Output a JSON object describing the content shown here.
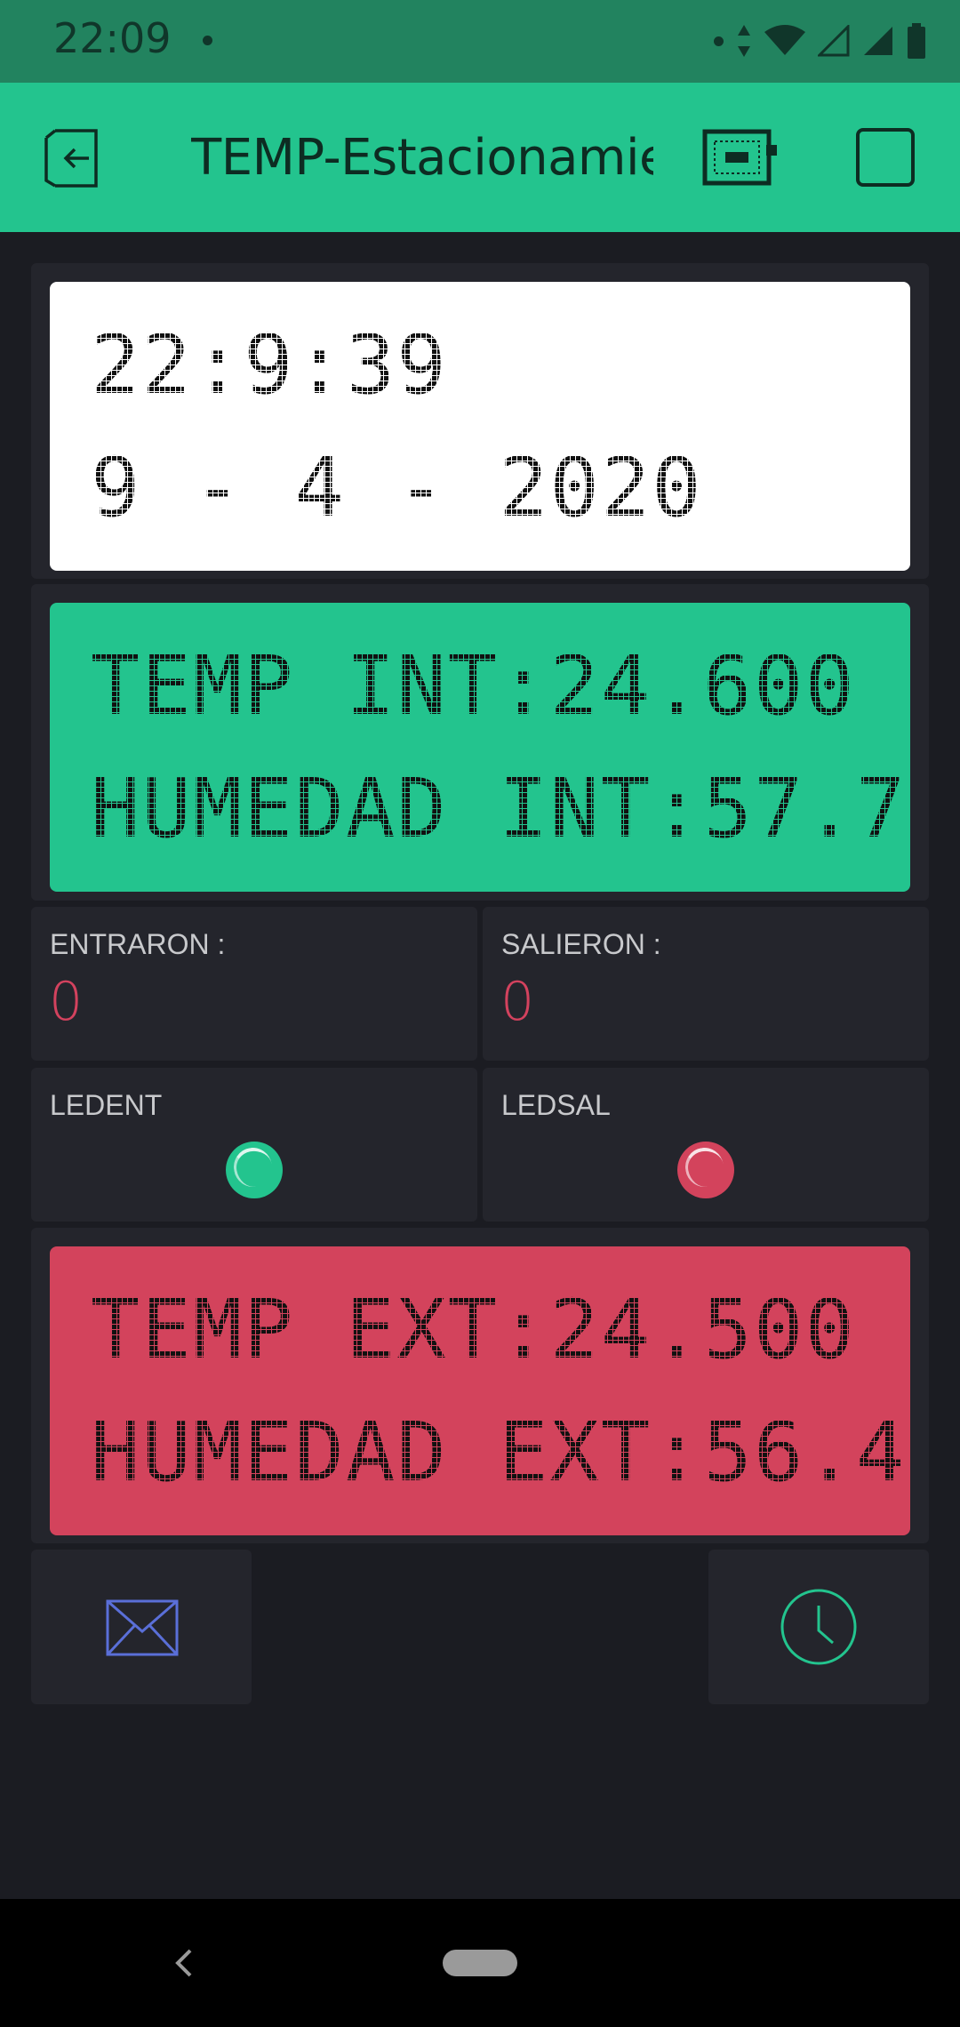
{
  "status_bar": {
    "time": "22:09"
  },
  "app_bar": {
    "title": "TEMP-Estacionamiento",
    "icons": [
      "exit-icon",
      "device-icon",
      "square-icon"
    ]
  },
  "widgets": {
    "datetime_lcd": {
      "line1": "22:9:39",
      "line2": "9 - 4 - 2020",
      "color": "#ffffff"
    },
    "interior_lcd": {
      "line1": "TEMP INT:24.600",
      "line2": "HUMEDAD INT:57.7",
      "color": "#23c48e"
    },
    "entraron": {
      "label": "ENTRARON :",
      "value": "0"
    },
    "salieron": {
      "label": "SALIERON :",
      "value": "0"
    },
    "ledent": {
      "label": "LEDENT",
      "color": "#23c48e"
    },
    "ledsal": {
      "label": "LEDSAL",
      "color": "#d3435c"
    },
    "exterior_lcd": {
      "line1": "TEMP EXT:24.500",
      "line2": "HUMEDAD EXT:56.4",
      "color": "#d3435c"
    },
    "email_widget": {
      "icon": "email-icon"
    },
    "timer_widget": {
      "icon": "clock-icon"
    }
  },
  "colors": {
    "background": "#1b1c22",
    "panel": "#24252c",
    "accent_green": "#23c48e",
    "accent_red": "#d3435c",
    "value_red": "#d3425e"
  }
}
